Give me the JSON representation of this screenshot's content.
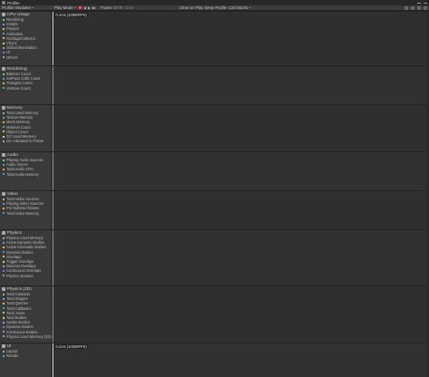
{
  "window": {
    "title": "Profiler"
  },
  "toolbar": {
    "modules_label": "Profiler Modules",
    "mode_label": "Play Mode",
    "frame_label": "Frame: 0 / 0",
    "clear_label": "Clear",
    "clear_on_play_label": "Clear on Play",
    "deep_profile_label": "Deep Profile",
    "call_stacks_label": "Call Stacks"
  },
  "selection": {
    "label": "0.1ms (10000FPS)"
  },
  "modules": [
    {
      "key": "cpu",
      "title": "CPU Usage",
      "icon": "cpu-icon",
      "items": [
        {
          "label": "Rendering",
          "color": "#8ec27a"
        },
        {
          "label": "Scripts",
          "color": "#5aa6d6"
        },
        {
          "label": "Physics",
          "color": "#e0b84a"
        },
        {
          "label": "Animation",
          "color": "#3fb0a5"
        },
        {
          "label": "GarbageCollector",
          "color": "#c7c262"
        },
        {
          "label": "VSync",
          "color": "#e0cf5d"
        },
        {
          "label": "Global Illumination",
          "color": "#c78dd6"
        },
        {
          "label": "UI",
          "color": "#6e8ad6"
        },
        {
          "label": "Others",
          "color": "#a58ccf"
        }
      ]
    },
    {
      "key": "rendering",
      "title": "Rendering",
      "icon": "rendering-icon",
      "items": [
        {
          "label": "Batches Count",
          "color": "#8ec27a"
        },
        {
          "label": "SetPass Calls Count",
          "color": "#5aa6d6"
        },
        {
          "label": "Triangles Count",
          "color": "#e0b84a"
        },
        {
          "label": "Vertices Count",
          "color": "#3fb0a5"
        }
      ]
    },
    {
      "key": "memory",
      "title": "Memory",
      "icon": "memory-icon",
      "items": [
        {
          "label": "Total Used Memory",
          "color": "#8ec27a"
        },
        {
          "label": "Texture Memory",
          "color": "#5aa6d6"
        },
        {
          "label": "Mesh Memory",
          "color": "#e0b84a"
        },
        {
          "label": "Material Count",
          "color": "#3fb0a5"
        },
        {
          "label": "Object Count",
          "color": "#c7c262"
        },
        {
          "label": "GC Used Memory",
          "color": "#e0cf5d"
        },
        {
          "label": "GC Allocated in Frame",
          "color": "#c78dd6"
        }
      ]
    },
    {
      "key": "audio",
      "title": "Audio",
      "icon": "audio-icon",
      "items": [
        {
          "label": "Playing Audio Sources",
          "color": "#8ec27a"
        },
        {
          "label": "Audio Voices",
          "color": "#5aa6d6"
        },
        {
          "label": "Total Audio CPU",
          "color": "#e0b84a"
        },
        {
          "label": "Total Audio Memory",
          "color": "#3fb0a5"
        }
      ]
    },
    {
      "key": "video",
      "title": "Video",
      "icon": "video-icon",
      "items": [
        {
          "label": "Total Video Sources",
          "color": "#8ec27a"
        },
        {
          "label": "Playing Video Sources",
          "color": "#5aa6d6"
        },
        {
          "label": "Pre-buffered frames",
          "color": "#e0b84a"
        },
        {
          "label": "Total Video Memory",
          "color": "#3fb0a5"
        }
      ]
    },
    {
      "key": "physics",
      "title": "Physics",
      "icon": "physics-icon",
      "items": [
        {
          "label": "Physics Used Memory",
          "color": "#8ec27a"
        },
        {
          "label": "Active Dynamic Bodies",
          "color": "#5aa6d6"
        },
        {
          "label": "Active Kinematic Bodies",
          "color": "#e0b84a"
        },
        {
          "label": "Dynamic Bodies",
          "color": "#3fb0a5"
        },
        {
          "label": "Overlaps",
          "color": "#c7c262"
        },
        {
          "label": "Trigger Overlaps",
          "color": "#e0cf5d"
        },
        {
          "label": "Discreet Overlaps",
          "color": "#c78dd6"
        },
        {
          "label": "Continuous Overlaps",
          "color": "#6e8ad6"
        },
        {
          "label": "Physics Queries",
          "color": "#a58ccf"
        }
      ]
    },
    {
      "key": "physics2d",
      "title": "Physics (2D)",
      "icon": "physics2d-icon",
      "items": [
        {
          "label": "Total Contacts",
          "color": "#8ec27a"
        },
        {
          "label": "Total Shapes",
          "color": "#5aa6d6"
        },
        {
          "label": "Total Queries",
          "color": "#e0b84a"
        },
        {
          "label": "Total Callbacks",
          "color": "#3fb0a5"
        },
        {
          "label": "Total Joints",
          "color": "#c7c262"
        },
        {
          "label": "Total Bodies",
          "color": "#e0cf5d"
        },
        {
          "label": "Awake Bodies",
          "color": "#c78dd6"
        },
        {
          "label": "Dynamic Bodies",
          "color": "#6e8ad6"
        },
        {
          "label": "Continuous Bodies",
          "color": "#a58ccf"
        },
        {
          "label": "Physics Used Memory (2D)",
          "color": "#d68d8d"
        }
      ]
    },
    {
      "key": "ui",
      "title": "UI",
      "icon": "ui-icon",
      "items": [
        {
          "label": "Layout",
          "color": "#8ec27a"
        },
        {
          "label": "Render",
          "color": "#5aa6d6"
        }
      ]
    }
  ]
}
